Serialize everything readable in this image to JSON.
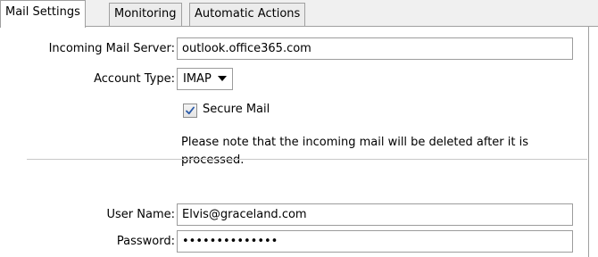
{
  "tabs": [
    {
      "label": "Mail Settings",
      "active": true
    },
    {
      "label": "Monitoring",
      "active": false
    },
    {
      "label": "Automatic Actions",
      "active": false
    }
  ],
  "server": {
    "label": "Incoming Mail Server:",
    "value": "outlook.office365.com"
  },
  "account_type": {
    "label": "Account Type:",
    "value": "IMAP"
  },
  "secure_mail": {
    "label": "Secure Mail",
    "checked": true
  },
  "note": {
    "text": "Please note that the incoming mail will be deleted after it is processed."
  },
  "username": {
    "label": "User Name:",
    "value": "Elvis@graceland.com"
  },
  "password": {
    "label": "Password:",
    "value": "••••••••••••••"
  },
  "colors": {
    "check_mark": "#2a5aa8",
    "border": "#9c9c9c"
  }
}
